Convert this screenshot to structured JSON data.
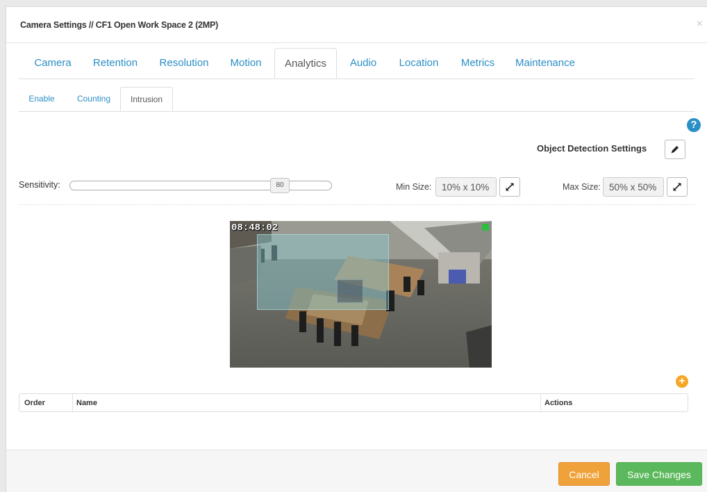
{
  "modal": {
    "title": "Camera Settings // CF1 Open Work Space 2 (2MP)",
    "close_glyph": "×"
  },
  "main_tabs": [
    {
      "label": "Camera"
    },
    {
      "label": "Retention"
    },
    {
      "label": "Resolution"
    },
    {
      "label": "Motion"
    },
    {
      "label": "Analytics",
      "active": true
    },
    {
      "label": "Audio"
    },
    {
      "label": "Location"
    },
    {
      "label": "Metrics"
    },
    {
      "label": "Maintenance"
    }
  ],
  "sub_tabs": [
    {
      "label": "Enable"
    },
    {
      "label": "Counting"
    },
    {
      "label": "Intrusion",
      "active": true
    }
  ],
  "help_glyph": "?",
  "object_detection": {
    "label": "Object Detection Settings",
    "edit_icon": "pencil-icon"
  },
  "sensitivity": {
    "label": "Sensitivity:",
    "value": "80",
    "level_fraction": 0.8
  },
  "min_size": {
    "label": "Min Size:",
    "value": "10% x 10%",
    "icon": "expand-icon"
  },
  "max_size": {
    "label": "Max Size:",
    "value": "50% x 50%",
    "icon": "expand-icon"
  },
  "camera": {
    "timestamp": "08:48:02",
    "status_color": "#2ebd3c"
  },
  "add_glyph": "+",
  "table": {
    "headers": [
      "Order",
      "Name",
      "Actions"
    ]
  },
  "footer": {
    "cancel_label": "Cancel",
    "save_label": "Save Changes"
  },
  "colors": {
    "link": "#2a8fc6",
    "cancel": "#f0a23a",
    "save": "#5cb85c",
    "add": "#f5a623"
  }
}
